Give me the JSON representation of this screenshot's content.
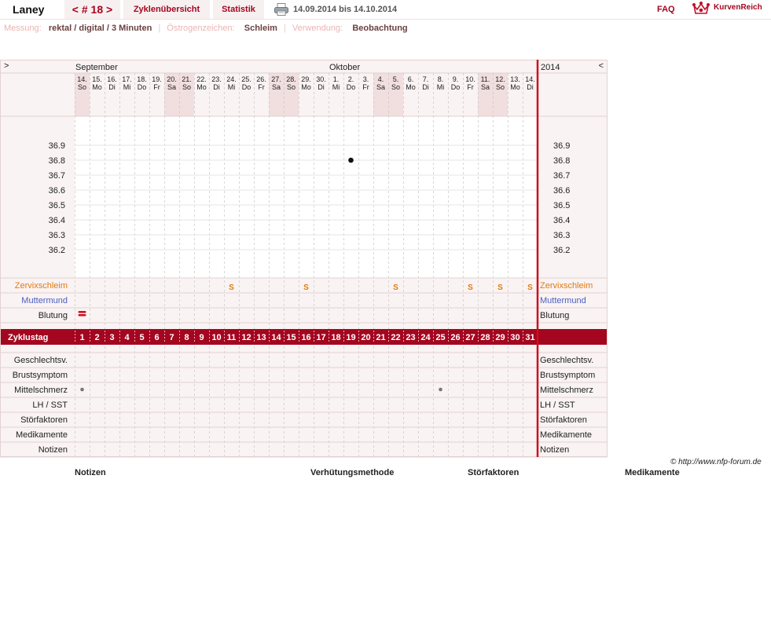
{
  "header": {
    "name": "Laney",
    "cycle_prev": "<",
    "cycle_label": "# 18",
    "cycle_next": ">",
    "overview_label": "Zyklenübersicht",
    "stats_label": "Statistik",
    "range": "14.09.2014 bis 14.10.2014",
    "faq_label": "FAQ",
    "logo_text": "KurvenReich"
  },
  "info": {
    "measure_label": "Messung:",
    "measure_value": "rektal / digital / 3 Minuten",
    "estrogen_label": "Östrogenzeichen:",
    "estrogen_value": "Schleim",
    "usage_label": "Verwendung:",
    "usage_value": "Beobachtung"
  },
  "chart": {
    "nav_left": ">",
    "nav_right": "<",
    "month_sep": "September",
    "month_oct": "Oktober",
    "year": "2014",
    "days": [
      {
        "d": "14.",
        "w": "So"
      },
      {
        "d": "15.",
        "w": "Mo"
      },
      {
        "d": "16.",
        "w": "Di"
      },
      {
        "d": "17.",
        "w": "Mi"
      },
      {
        "d": "18.",
        "w": "Do"
      },
      {
        "d": "19.",
        "w": "Fr"
      },
      {
        "d": "20.",
        "w": "Sa"
      },
      {
        "d": "21.",
        "w": "So"
      },
      {
        "d": "22.",
        "w": "Mo"
      },
      {
        "d": "23.",
        "w": "Di"
      },
      {
        "d": "24.",
        "w": "Mi"
      },
      {
        "d": "25.",
        "w": "Do"
      },
      {
        "d": "26.",
        "w": "Fr"
      },
      {
        "d": "27.",
        "w": "Sa"
      },
      {
        "d": "28.",
        "w": "So"
      },
      {
        "d": "29.",
        "w": "Mo"
      },
      {
        "d": "30.",
        "w": "Di"
      },
      {
        "d": "1.",
        "w": "Mi"
      },
      {
        "d": "2.",
        "w": "Do"
      },
      {
        "d": "3.",
        "w": "Fr"
      },
      {
        "d": "4.",
        "w": "Sa"
      },
      {
        "d": "5.",
        "w": "So"
      },
      {
        "d": "6.",
        "w": "Mo"
      },
      {
        "d": "7.",
        "w": "Di"
      },
      {
        "d": "8.",
        "w": "Mi"
      },
      {
        "d": "9.",
        "w": "Do"
      },
      {
        "d": "10.",
        "w": "Fr"
      },
      {
        "d": "11.",
        "w": "Sa"
      },
      {
        "d": "12.",
        "w": "So"
      },
      {
        "d": "13.",
        "w": "Mo"
      },
      {
        "d": "14.",
        "w": "Di"
      }
    ],
    "temp_ticks": [
      "36.9",
      "36.8",
      "36.7",
      "36.6",
      "36.5",
      "36.4",
      "36.3",
      "36.2"
    ],
    "temperatures": [
      {
        "cycle_day": 19,
        "value": 36.8
      }
    ],
    "rows_top": [
      {
        "key": "zervix",
        "label": "Zervixschleim",
        "color": "#e07a10"
      },
      {
        "key": "muttermund",
        "label": "Muttermund",
        "color": "#4a5fc0"
      },
      {
        "key": "blutung",
        "label": "Blutung",
        "color": "#222222"
      }
    ],
    "mucus_symbol": "S",
    "mucus_days": [
      11,
      16,
      22,
      27,
      29,
      31
    ],
    "bleeding_days": [
      1
    ],
    "cycle_day_label": "Zyklustag",
    "cycle_days": [
      "1",
      "2",
      "3",
      "4",
      "5",
      "6",
      "7",
      "8",
      "9",
      "10",
      "11",
      "12",
      "13",
      "14",
      "15",
      "16",
      "17",
      "18",
      "19",
      "20",
      "21",
      "22",
      "23",
      "24",
      "25",
      "26",
      "27",
      "28",
      "29",
      "30",
      "31"
    ],
    "rows_bottom": [
      {
        "key": "geschlecht",
        "label": "Geschlechtsv."
      },
      {
        "key": "brust",
        "label": "Brustsymptom"
      },
      {
        "key": "mittelschmerz",
        "label": "Mittelschmerz"
      },
      {
        "key": "lh",
        "label": "LH / SST"
      },
      {
        "key": "stoer",
        "label": "Störfaktoren"
      },
      {
        "key": "medi",
        "label": "Medikamente"
      },
      {
        "key": "notizen",
        "label": "Notizen"
      }
    ],
    "mittelschmerz_days": [
      1,
      25
    ],
    "colors": {
      "accent": "#a4061f",
      "weekend": "#f1dede",
      "panel": "#f9f3f3",
      "grid": "#c8c8c8",
      "border": "#e2d2d2"
    }
  },
  "footer": {
    "copyright": "© http://www.nfp-forum.de",
    "legend_notizen": "Notizen",
    "legend_methode": "Verhütungsmethode",
    "legend_stoer": "Störfaktoren",
    "legend_medi": "Medikamente"
  }
}
